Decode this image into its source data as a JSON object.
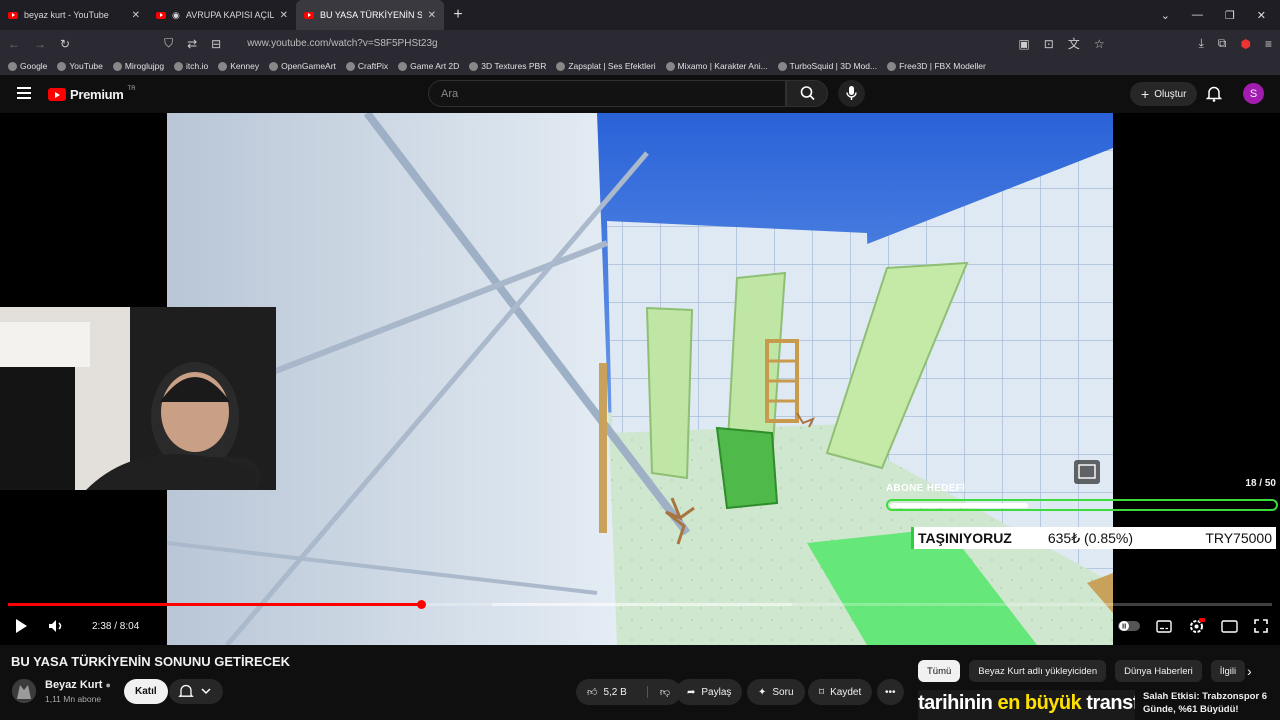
{
  "browser": {
    "tabs": [
      {
        "title": "beyaz kurt - YouTube",
        "active": false
      },
      {
        "title": "AVRUPA KAPISI AÇILIYOR: E",
        "active": false
      },
      {
        "title": "BU YASA TÜRKİYENİN SONUNU",
        "active": true
      }
    ],
    "url": "www.youtube.com/watch?v=S8F5PHSt23g",
    "bookmarks": [
      "Google",
      "YouTube",
      "Miroglujpg",
      "itch.io",
      "Kenney",
      "OpenGameArt",
      "CraftPix",
      "Game Art 2D",
      "3D Textures PBR",
      "Zapsplat | Ses Efektleri",
      "Mixamo | Karakter Ani...",
      "TurboSquid | 3D Mod...",
      "Free3D | FBX Modeller"
    ]
  },
  "youtube": {
    "logo_text": "Premium",
    "logo_region": "TR",
    "search_placeholder": "Ara",
    "create_label": "Oluştur",
    "avatar_letter": "S"
  },
  "player": {
    "overlay_goal_label": "ABONE HEDEFİ",
    "overlay_goal_count": "18 / 50",
    "goal_fraction": 0.36,
    "ticker_label": "TAŞINIYORUZ",
    "ticker_amount": "635₺ (0.85%)",
    "ticker_target": "TRY75000",
    "time_current": "2:38",
    "time_total": "8:04",
    "time_display": "2:38 / 8:04",
    "played_fraction": 0.327,
    "buffered_start": 0.383,
    "buffered_fraction": 0.62
  },
  "video": {
    "title": "BU YASA TÜRKİYENİN SONUNU GETİRECEK",
    "channel": "Beyaz Kurt",
    "subscribers": "1,11 Mn abone",
    "join_label": "Katıl",
    "likes": "5,2 B",
    "share_label": "Paylaş",
    "ask_label": "Soru",
    "save_label": "Kaydet"
  },
  "sidebar": {
    "chips": [
      {
        "label": "Tümü",
        "active": true
      },
      {
        "label": "Beyaz Kurt adlı yükleyiciden",
        "active": false
      },
      {
        "label": "Dünya Haberleri",
        "active": false
      },
      {
        "label": "İlgili",
        "active": false
      }
    ],
    "thumb_text_a": "tarihinin ",
    "thumb_text_b": "en büyük",
    "thumb_text_c": " transferi",
    "rec_title": "Salah Etkisi: Trabzonspor 6 Günde, %61 Büyüdü!"
  }
}
